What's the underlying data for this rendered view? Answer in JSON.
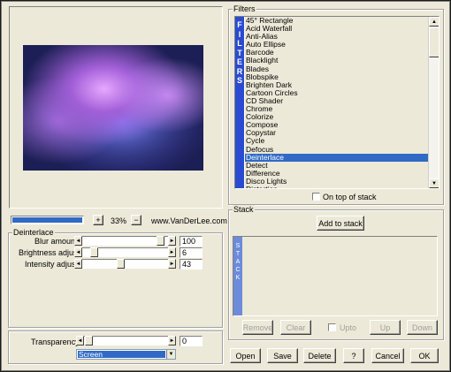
{
  "preview": {
    "zoom_percent": "33%",
    "zoom_in_label": "+",
    "zoom_out_label": "−",
    "site": "www.VanDerLee.com",
    "progress": 1.0
  },
  "deinterlace": {
    "title": "Deinterlace",
    "sliders": [
      {
        "label": "Blur amount",
        "value": "100",
        "fraction": 1.0
      },
      {
        "label": "Brightness adjust",
        "value": "6",
        "fraction": 0.06
      },
      {
        "label": "Intensity adjust",
        "value": "43",
        "fraction": 0.43
      }
    ]
  },
  "transparency": {
    "label": "Transparency",
    "value": "0",
    "fraction": 0.0,
    "blend_mode": "Screen"
  },
  "filters": {
    "title": "Filters",
    "banner": [
      "F",
      "I",
      "L",
      "T",
      "E",
      "R",
      "S"
    ],
    "items": [
      "45° Rectangle",
      "Acid Waterfall",
      "Anti-Alias",
      "Auto Ellipse",
      "Barcode",
      "Blacklight",
      "Blades",
      "Blobspike",
      "Brighten Dark",
      "Cartoon Circles",
      "CD Shader",
      "Chrome",
      "Colorize",
      "Compose",
      "Copystar",
      "Cycle",
      "Defocus",
      "Deinterlace",
      "Detect",
      "Difference",
      "Disco Lights",
      "Distortion"
    ],
    "selected": "Deinterlace",
    "on_top_label": "On top of stack"
  },
  "stack": {
    "title": "Stack",
    "add_label": "Add to stack",
    "banner": [
      "S",
      "T",
      "A",
      "C",
      "K"
    ],
    "remove_label": "Remove",
    "clear_label": "Clear",
    "upto_label": "Upto",
    "up_label": "Up",
    "down_label": "Down"
  },
  "footer": {
    "open": "Open",
    "save": "Save",
    "delete": "Delete",
    "help": "?",
    "cancel": "Cancel",
    "ok": "OK"
  },
  "colors": {
    "dialog_bg": "#ece9d8",
    "selection": "#316ac5",
    "banner": "#2a4bd0"
  }
}
